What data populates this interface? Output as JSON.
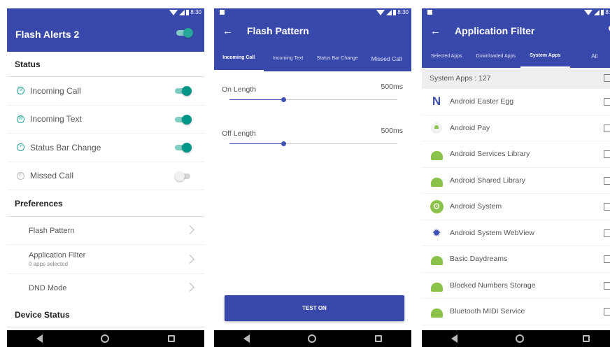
{
  "status_bar": {
    "time": "8:30"
  },
  "screen1": {
    "title": "Flash Alerts 2",
    "status_header": "Status",
    "alerts": [
      {
        "label": "Incoming Call",
        "enabled": true
      },
      {
        "label": "Incoming Text",
        "enabled": true
      },
      {
        "label": "Status Bar Change",
        "enabled": true
      },
      {
        "label": "Missed Call",
        "enabled": false
      }
    ],
    "preferences_header": "Preferences",
    "flash_pattern": "Flash Pattern",
    "application_filter": "Application Filter",
    "apps_selected": "0 apps selected",
    "dnd_mode": "DND Mode",
    "device_status_header": "Device Status"
  },
  "screen2": {
    "title": "Flash Pattern",
    "tabs": [
      "Incoming Call",
      "Incoming Text",
      "Status Bar Change",
      "Missed Call"
    ],
    "on_length_label": "On Length",
    "on_length_value": "500ms",
    "on_length_fraction": 0.32,
    "off_length_label": "Off Length",
    "off_length_value": "500ms",
    "off_length_fraction": 0.32,
    "test_button": "TEST ON"
  },
  "screen3": {
    "title": "Application Filter",
    "tabs": [
      "Selected Apps",
      "Downloaded Apps",
      "System Apps",
      "All"
    ],
    "system_apps_header": "System Apps : 127",
    "apps": [
      "Android Easter Egg",
      "Android Pay",
      "Android Services Library",
      "Android Shared Library",
      "Android System",
      "Android System WebView",
      "Basic Daydreams",
      "Blocked Numbers Storage",
      "Bluetooth MIDI Service"
    ]
  },
  "colors": {
    "primary": "#3949ab",
    "accent": "#009688"
  }
}
